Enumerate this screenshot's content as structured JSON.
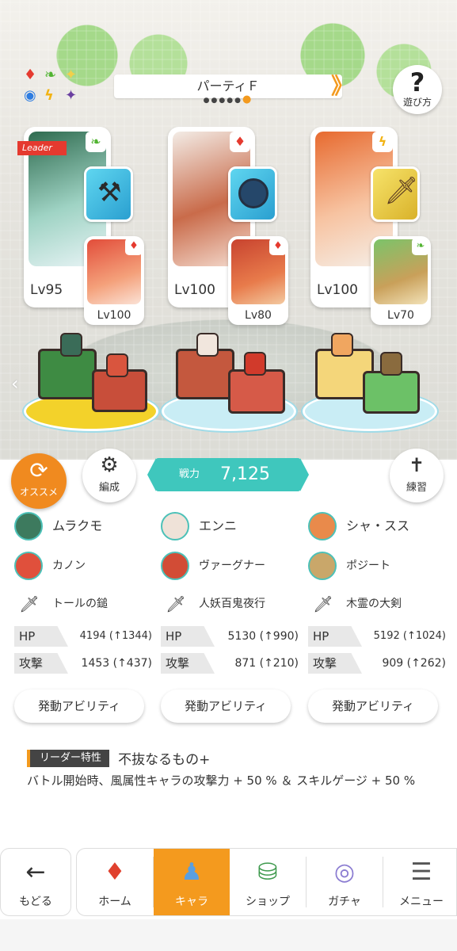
{
  "party": {
    "title": "パーティＦ",
    "page_count": 6,
    "active_page": 6
  },
  "help": {
    "label": "遊び方",
    "icon": "?"
  },
  "elements": {
    "icons": [
      "diamond-suit-icon",
      "leaf-icon",
      "sparkle-icon",
      "circle-icon",
      "lightning-icon",
      "dark-star-icon"
    ]
  },
  "characters": [
    {
      "leader_label": "Leader",
      "main_level": "Lv95",
      "sub_level": "Lv100",
      "main_attr": "leaf",
      "sub_attr": "fire",
      "main_attr_color": "#52b432",
      "sub_attr_color": "#e53a2f"
    },
    {
      "leader_label": "",
      "main_level": "Lv100",
      "sub_level": "Lv80",
      "main_attr": "fire",
      "sub_attr": "fire",
      "main_attr_color": "#e53a2f",
      "sub_attr_color": "#e53a2f"
    },
    {
      "leader_label": "",
      "main_level": "Lv100",
      "sub_level": "Lv70",
      "main_attr": "lightning",
      "sub_attr": "leaf",
      "main_attr_color": "#f2b313",
      "sub_attr_color": "#52b432"
    }
  ],
  "controls": {
    "recommend_label": "オススメ",
    "formation_label": "編成",
    "power_label": "戦力",
    "power_value": "7,125",
    "training_label": "練習"
  },
  "columns": [
    {
      "main_name": "ムラクモ",
      "sub_name": "カノン",
      "weapon": "トールの鎚",
      "hp_label": "HP",
      "hp": "4194 (↑1344)",
      "atk_label": "攻撃",
      "atk": "1453 (↑437)",
      "ability_label": "発動アビリティ"
    },
    {
      "main_name": "エンニ",
      "sub_name": "ヴァーグナー",
      "weapon": "人妖百鬼夜行",
      "hp_label": "HP",
      "hp": "5130 (↑990)",
      "atk_label": "攻撃",
      "atk": "871 (↑210)",
      "ability_label": "発動アビリティ"
    },
    {
      "main_name": "シャ・スス",
      "sub_name": "ポジート",
      "weapon": "木霊の大剣",
      "hp_label": "HP",
      "hp": "5192 (↑1024)",
      "atk_label": "攻撃",
      "atk": "909 (↑262)",
      "ability_label": "発動アビリティ"
    }
  ],
  "leader_skill": {
    "tag": "リーダー特性",
    "name": "不抜なるもの+",
    "description": "バトル開始時、風属性キャラの攻撃力 + 50 % ＆ スキルゲージ + 50 %"
  },
  "nav": {
    "back_label": "もどる",
    "items": [
      {
        "label": "ホーム",
        "icon": "home-icon"
      },
      {
        "label": "キャラ",
        "icon": "character-icon"
      },
      {
        "label": "ショップ",
        "icon": "shop-icon"
      },
      {
        "label": "ガチャ",
        "icon": "gacha-icon"
      },
      {
        "label": "メニュー",
        "icon": "menu-icon"
      }
    ],
    "active_item": "キャラ"
  },
  "colors": {
    "accent_orange": "#f39a1e",
    "power_teal": "#3fc7bd",
    "leader_red": "#e53a2f"
  }
}
